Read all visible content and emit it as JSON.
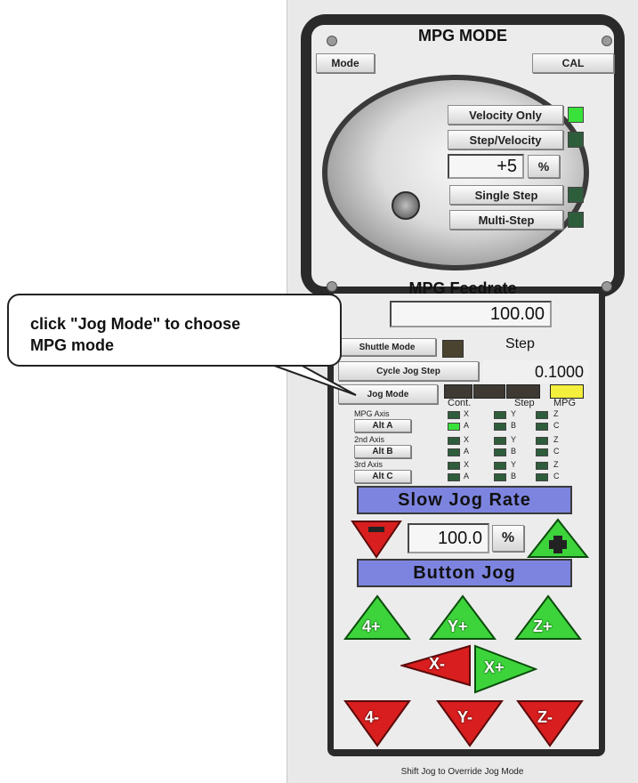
{
  "mpg": {
    "title": "MPG MODE",
    "mode_button": "Mode",
    "cal_button": "CAL",
    "velocity_only": "Velocity Only",
    "step_velocity": "Step/Velocity",
    "percent_value": "+5",
    "percent_button": "%",
    "single_step": "Single Step",
    "multi_step": "Multi-Step",
    "velocity_only_led_on": true
  },
  "feedrate": {
    "title": "MPG Feedrate",
    "value": "100.00"
  },
  "jog": {
    "shuttle_mode": "Shuttle Mode",
    "step_label": "Step",
    "cycle_jog_step": "Cycle Jog Step",
    "cycle_value": "0.1000",
    "jog_mode": "Jog Mode",
    "col_cont": "Cont.",
    "col_step": "Step",
    "col_mpg": "MPG",
    "axis_rows": [
      {
        "label": "MPG Axis",
        "button": "Alt A",
        "a": [
          "X",
          "A"
        ],
        "b": [
          "Y",
          "B"
        ],
        "c": [
          "Z",
          "C"
        ],
        "led_on": "A"
      },
      {
        "label": "2nd Axis",
        "button": "Alt B",
        "a": [
          "X",
          "A"
        ],
        "b": [
          "Y",
          "B"
        ],
        "c": [
          "Z",
          "C"
        ],
        "led_on": ""
      },
      {
        "label": "3rd Axis",
        "button": "Alt C",
        "a": [
          "X",
          "A"
        ],
        "b": [
          "Y",
          "B"
        ],
        "c": [
          "Z",
          "C"
        ],
        "led_on": ""
      }
    ],
    "slow_jog_rate": "Slow Jog Rate",
    "rate_value": "100.0",
    "rate_percent": "%",
    "button_jog": "Button Jog",
    "buttons": {
      "minus": "-",
      "plus": "+",
      "a4_plus": "4+",
      "y_plus": "Y+",
      "z_plus": "Z+",
      "x_minus": "X-",
      "x_plus": "X+",
      "a4_minus": "4-",
      "y_minus": "Y-",
      "z_minus": "Z-"
    }
  },
  "callout": {
    "line1": "click \"Jog Mode\" to choose",
    "line2": "MPG mode"
  },
  "status": "Shift Jog to Override Jog Mode",
  "colors": {
    "led_on": "#39e23b",
    "led_off": "#2e5d3c",
    "banner": "#7d84e0",
    "arrow_red": "#d81e1e",
    "arrow_green": "#3dd43b",
    "jog_indicator": "#f4ef3c"
  }
}
